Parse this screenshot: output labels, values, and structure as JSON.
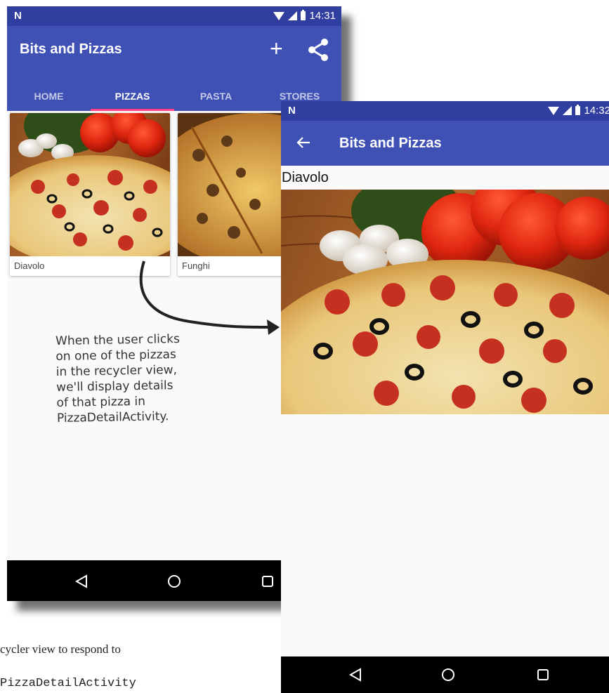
{
  "phone_left": {
    "status": {
      "time": "14:31"
    },
    "app_title": "Bits and Pizzas",
    "actions": {
      "add": "+",
      "share": "share"
    },
    "tabs": [
      {
        "label": "HOME",
        "active": false
      },
      {
        "label": "PIZZAS",
        "active": true
      },
      {
        "label": "PASTA",
        "active": false
      },
      {
        "label": "STORES",
        "active": false
      }
    ],
    "cards": [
      {
        "caption": "Diavolo"
      },
      {
        "caption": "Funghi"
      }
    ]
  },
  "phone_right": {
    "status": {
      "time": "14:32"
    },
    "app_title": "Bits and Pizzas",
    "pizza_name": "Diavolo"
  },
  "annotation": {
    "text": "When the user clicks\non one of the pizzas\nin the recycler view,\nwe'll display details\nof that pizza in\nPizzaDetailActivity."
  },
  "page_text": {
    "line1": "cycler view to respond to",
    "line2": "PizzaDetailActivity"
  },
  "colors": {
    "primary": "#3f51b5",
    "primary_dark": "#303f9f",
    "accent": "#ff4081"
  },
  "icons": [
    "n-logo-icon",
    "wifi-icon",
    "signal-icon",
    "battery-icon",
    "plus-icon",
    "share-icon",
    "back-arrow-icon",
    "nav-back-icon",
    "nav-home-icon",
    "nav-recent-icon"
  ]
}
